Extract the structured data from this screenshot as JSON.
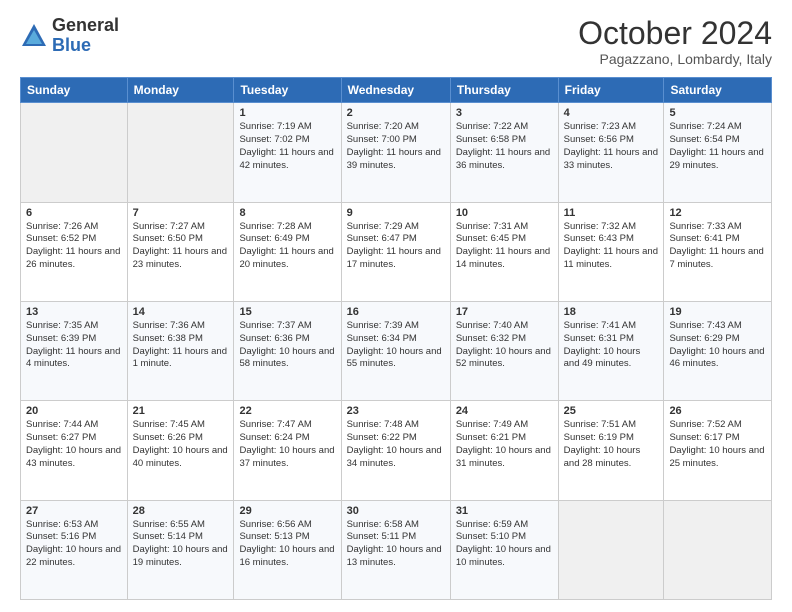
{
  "logo": {
    "general": "General",
    "blue": "Blue"
  },
  "title": "October 2024",
  "subtitle": "Pagazzano, Lombardy, Italy",
  "header_days": [
    "Sunday",
    "Monday",
    "Tuesday",
    "Wednesday",
    "Thursday",
    "Friday",
    "Saturday"
  ],
  "weeks": [
    [
      {
        "day": "",
        "content": ""
      },
      {
        "day": "",
        "content": ""
      },
      {
        "day": "1",
        "content": "Sunrise: 7:19 AM\nSunset: 7:02 PM\nDaylight: 11 hours and 42 minutes."
      },
      {
        "day": "2",
        "content": "Sunrise: 7:20 AM\nSunset: 7:00 PM\nDaylight: 11 hours and 39 minutes."
      },
      {
        "day": "3",
        "content": "Sunrise: 7:22 AM\nSunset: 6:58 PM\nDaylight: 11 hours and 36 minutes."
      },
      {
        "day": "4",
        "content": "Sunrise: 7:23 AM\nSunset: 6:56 PM\nDaylight: 11 hours and 33 minutes."
      },
      {
        "day": "5",
        "content": "Sunrise: 7:24 AM\nSunset: 6:54 PM\nDaylight: 11 hours and 29 minutes."
      }
    ],
    [
      {
        "day": "6",
        "content": "Sunrise: 7:26 AM\nSunset: 6:52 PM\nDaylight: 11 hours and 26 minutes."
      },
      {
        "day": "7",
        "content": "Sunrise: 7:27 AM\nSunset: 6:50 PM\nDaylight: 11 hours and 23 minutes."
      },
      {
        "day": "8",
        "content": "Sunrise: 7:28 AM\nSunset: 6:49 PM\nDaylight: 11 hours and 20 minutes."
      },
      {
        "day": "9",
        "content": "Sunrise: 7:29 AM\nSunset: 6:47 PM\nDaylight: 11 hours and 17 minutes."
      },
      {
        "day": "10",
        "content": "Sunrise: 7:31 AM\nSunset: 6:45 PM\nDaylight: 11 hours and 14 minutes."
      },
      {
        "day": "11",
        "content": "Sunrise: 7:32 AM\nSunset: 6:43 PM\nDaylight: 11 hours and 11 minutes."
      },
      {
        "day": "12",
        "content": "Sunrise: 7:33 AM\nSunset: 6:41 PM\nDaylight: 11 hours and 7 minutes."
      }
    ],
    [
      {
        "day": "13",
        "content": "Sunrise: 7:35 AM\nSunset: 6:39 PM\nDaylight: 11 hours and 4 minutes."
      },
      {
        "day": "14",
        "content": "Sunrise: 7:36 AM\nSunset: 6:38 PM\nDaylight: 11 hours and 1 minute."
      },
      {
        "day": "15",
        "content": "Sunrise: 7:37 AM\nSunset: 6:36 PM\nDaylight: 10 hours and 58 minutes."
      },
      {
        "day": "16",
        "content": "Sunrise: 7:39 AM\nSunset: 6:34 PM\nDaylight: 10 hours and 55 minutes."
      },
      {
        "day": "17",
        "content": "Sunrise: 7:40 AM\nSunset: 6:32 PM\nDaylight: 10 hours and 52 minutes."
      },
      {
        "day": "18",
        "content": "Sunrise: 7:41 AM\nSunset: 6:31 PM\nDaylight: 10 hours and 49 minutes."
      },
      {
        "day": "19",
        "content": "Sunrise: 7:43 AM\nSunset: 6:29 PM\nDaylight: 10 hours and 46 minutes."
      }
    ],
    [
      {
        "day": "20",
        "content": "Sunrise: 7:44 AM\nSunset: 6:27 PM\nDaylight: 10 hours and 43 minutes."
      },
      {
        "day": "21",
        "content": "Sunrise: 7:45 AM\nSunset: 6:26 PM\nDaylight: 10 hours and 40 minutes."
      },
      {
        "day": "22",
        "content": "Sunrise: 7:47 AM\nSunset: 6:24 PM\nDaylight: 10 hours and 37 minutes."
      },
      {
        "day": "23",
        "content": "Sunrise: 7:48 AM\nSunset: 6:22 PM\nDaylight: 10 hours and 34 minutes."
      },
      {
        "day": "24",
        "content": "Sunrise: 7:49 AM\nSunset: 6:21 PM\nDaylight: 10 hours and 31 minutes."
      },
      {
        "day": "25",
        "content": "Sunrise: 7:51 AM\nSunset: 6:19 PM\nDaylight: 10 hours and 28 minutes."
      },
      {
        "day": "26",
        "content": "Sunrise: 7:52 AM\nSunset: 6:17 PM\nDaylight: 10 hours and 25 minutes."
      }
    ],
    [
      {
        "day": "27",
        "content": "Sunrise: 6:53 AM\nSunset: 5:16 PM\nDaylight: 10 hours and 22 minutes."
      },
      {
        "day": "28",
        "content": "Sunrise: 6:55 AM\nSunset: 5:14 PM\nDaylight: 10 hours and 19 minutes."
      },
      {
        "day": "29",
        "content": "Sunrise: 6:56 AM\nSunset: 5:13 PM\nDaylight: 10 hours and 16 minutes."
      },
      {
        "day": "30",
        "content": "Sunrise: 6:58 AM\nSunset: 5:11 PM\nDaylight: 10 hours and 13 minutes."
      },
      {
        "day": "31",
        "content": "Sunrise: 6:59 AM\nSunset: 5:10 PM\nDaylight: 10 hours and 10 minutes."
      },
      {
        "day": "",
        "content": ""
      },
      {
        "day": "",
        "content": ""
      }
    ]
  ]
}
